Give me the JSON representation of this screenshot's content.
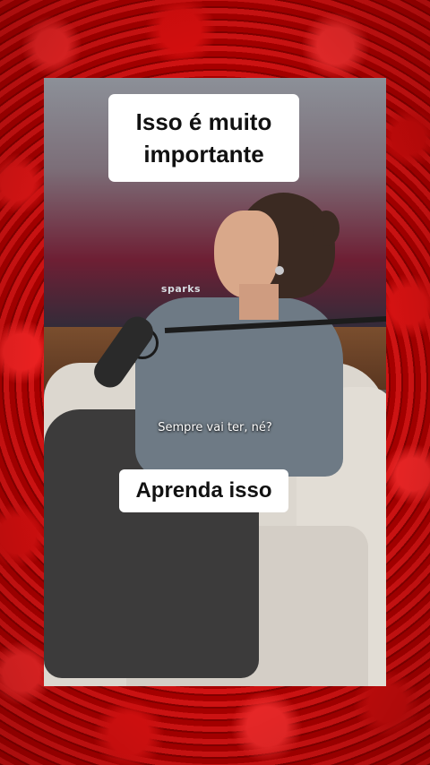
{
  "overlay": {
    "title_text": "Isso é  muito\nimportante",
    "cta_text": "Aprenda isso"
  },
  "video": {
    "subtitle": "Sempre vai ter, né?",
    "hoodie_print": "sparks"
  },
  "background": {
    "theme": "red-roses",
    "primary_color": "#d61010"
  }
}
